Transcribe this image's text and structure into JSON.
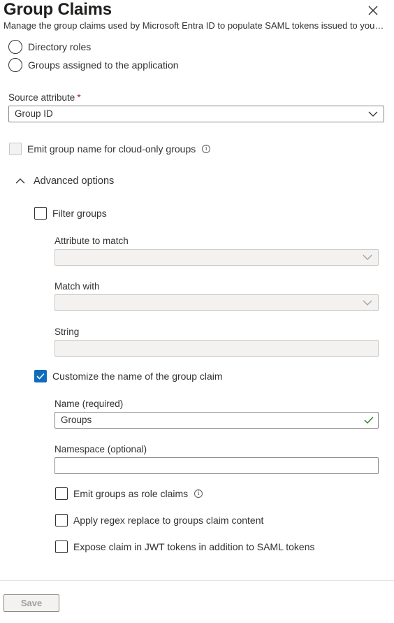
{
  "header": {
    "title": "Group Claims",
    "subtitle": "Manage the group claims used by Microsoft Entra ID to populate SAML tokens issued to your app..."
  },
  "group_type": {
    "options": [
      "Directory roles",
      "Groups assigned to the application"
    ]
  },
  "source_attribute": {
    "label": "Source attribute",
    "required_mark": "*",
    "value": "Group ID"
  },
  "cloud_only": {
    "label": "Emit group name for cloud-only groups",
    "info": "i"
  },
  "advanced": {
    "label": "Advanced options",
    "filter_groups": {
      "label": "Filter groups",
      "attribute_label": "Attribute to match",
      "attribute_value": "",
      "match_label": "Match with",
      "match_value": "",
      "string_label": "String",
      "string_value": ""
    },
    "customize": {
      "label": "Customize the name of the group claim",
      "name_label": "Name (required)",
      "name_value": "Groups",
      "namespace_label": "Namespace (optional)",
      "namespace_value": ""
    },
    "role_claims": {
      "label": "Emit groups as role claims",
      "info": "i"
    },
    "regex": {
      "label": "Apply regex replace to groups claim content"
    },
    "jwt": {
      "label": "Expose claim in JWT tokens in addition to SAML tokens"
    }
  },
  "footer": {
    "save_label": "Save"
  },
  "colors": {
    "accent": "#0f6cbd",
    "required": "#a4262c",
    "valid": "#107c10"
  }
}
